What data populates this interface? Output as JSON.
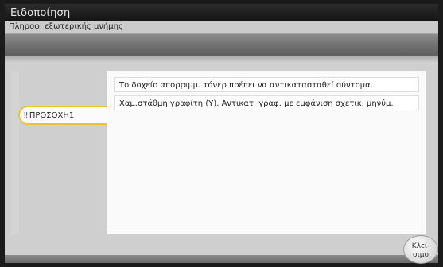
{
  "header": {
    "title": "Ειδοποίηση",
    "subtitle": "Πληροφ. εξωτερικής μνήμης"
  },
  "tabs": [
    {
      "label": "ΠΡΟΣΟΧΗ1",
      "icon": "warning-icon",
      "selected": true
    }
  ],
  "messages": [
    "Το δοχείο απορριμμ. τόνερ πρέπει να αντικατασταθεί σύντομα.",
    "Χαμ.στάθμη γραφίτη (Y). Αντικατ. γραφ. με εμφάνιση σχετικ. μηνύμ."
  ],
  "footer": {
    "close_label": "Κλεί-\nσιμο"
  },
  "colors": {
    "tab_border": "#e6c53a",
    "titlebar": "#1a1a1a"
  }
}
